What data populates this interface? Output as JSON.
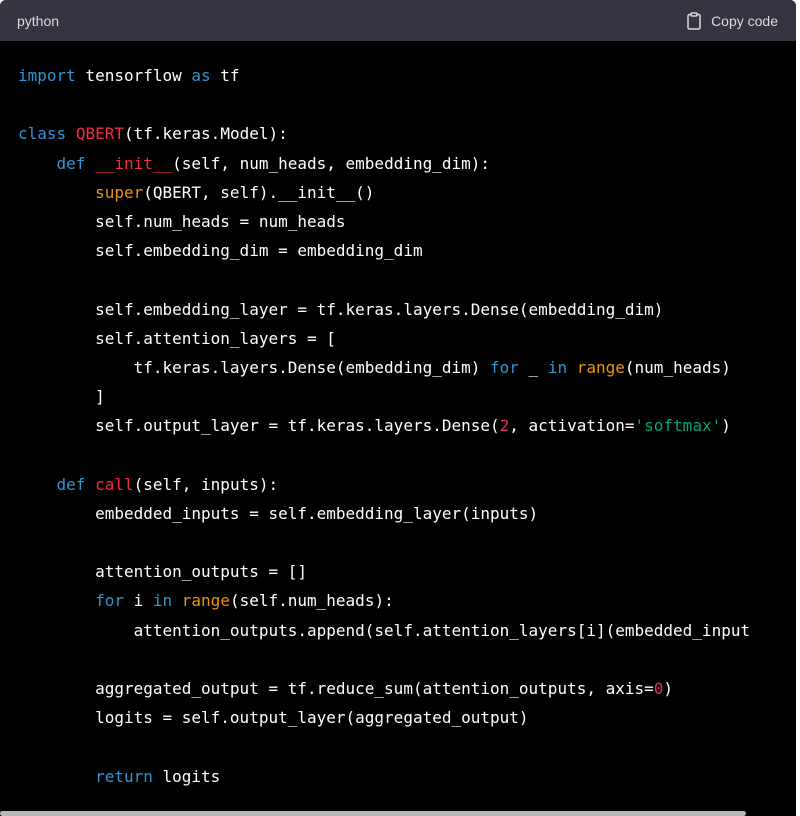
{
  "header": {
    "language": "python",
    "copy_label": "Copy code"
  },
  "colors": {
    "keyword": "#2e95d3",
    "class_name": "#f22c3d",
    "builtin": "#e9950c",
    "string": "#00a67d",
    "number": "#df3079",
    "header_bg": "#343541",
    "code_bg": "#000000"
  },
  "icons": {
    "copy": "clipboard-icon"
  },
  "code_lines": [
    [
      {
        "t": "kw",
        "v": "import"
      },
      {
        "t": "p",
        "v": " tensorflow "
      },
      {
        "t": "kw",
        "v": "as"
      },
      {
        "t": "p",
        "v": " tf"
      }
    ],
    [],
    [
      {
        "t": "kw",
        "v": "class"
      },
      {
        "t": "p",
        "v": " "
      },
      {
        "t": "cls",
        "v": "QBERT"
      },
      {
        "t": "p",
        "v": "(tf.keras.Model):"
      }
    ],
    [
      {
        "t": "p",
        "v": "    "
      },
      {
        "t": "kw",
        "v": "def"
      },
      {
        "t": "p",
        "v": " "
      },
      {
        "t": "cls",
        "v": "__init__"
      },
      {
        "t": "p",
        "v": "(self, num_heads, embedding_dim):"
      }
    ],
    [
      {
        "t": "p",
        "v": "        "
      },
      {
        "t": "bi",
        "v": "super"
      },
      {
        "t": "p",
        "v": "(QBERT, self).__init__()"
      }
    ],
    [
      {
        "t": "p",
        "v": "        self.num_heads = num_heads"
      }
    ],
    [
      {
        "t": "p",
        "v": "        self.embedding_dim = embedding_dim"
      }
    ],
    [],
    [
      {
        "t": "p",
        "v": "        self.embedding_layer = tf.keras.layers.Dense(embedding_dim)"
      }
    ],
    [
      {
        "t": "p",
        "v": "        self.attention_layers = ["
      }
    ],
    [
      {
        "t": "p",
        "v": "            tf.keras.layers.Dense(embedding_dim) "
      },
      {
        "t": "kw",
        "v": "for"
      },
      {
        "t": "p",
        "v": " _ "
      },
      {
        "t": "kw",
        "v": "in"
      },
      {
        "t": "p",
        "v": " "
      },
      {
        "t": "bi",
        "v": "range"
      },
      {
        "t": "p",
        "v": "(num_heads)"
      }
    ],
    [
      {
        "t": "p",
        "v": "        ]"
      }
    ],
    [
      {
        "t": "p",
        "v": "        self.output_layer = tf.keras.layers.Dense("
      },
      {
        "t": "num",
        "v": "2"
      },
      {
        "t": "p",
        "v": ", activation="
      },
      {
        "t": "str",
        "v": "'softmax'"
      },
      {
        "t": "p",
        "v": ")"
      }
    ],
    [],
    [
      {
        "t": "p",
        "v": "    "
      },
      {
        "t": "kw",
        "v": "def"
      },
      {
        "t": "p",
        "v": " "
      },
      {
        "t": "cls",
        "v": "call"
      },
      {
        "t": "p",
        "v": "(self, inputs):"
      }
    ],
    [
      {
        "t": "p",
        "v": "        embedded_inputs = self.embedding_layer(inputs)"
      }
    ],
    [],
    [
      {
        "t": "p",
        "v": "        attention_outputs = []"
      }
    ],
    [
      {
        "t": "p",
        "v": "        "
      },
      {
        "t": "kw",
        "v": "for"
      },
      {
        "t": "p",
        "v": " i "
      },
      {
        "t": "kw",
        "v": "in"
      },
      {
        "t": "p",
        "v": " "
      },
      {
        "t": "bi",
        "v": "range"
      },
      {
        "t": "p",
        "v": "(self.num_heads):"
      }
    ],
    [
      {
        "t": "p",
        "v": "            attention_outputs.append(self.attention_layers[i](embedded_input"
      }
    ],
    [],
    [
      {
        "t": "p",
        "v": "        aggregated_output = tf.reduce_sum(attention_outputs, axis="
      },
      {
        "t": "num",
        "v": "0"
      },
      {
        "t": "p",
        "v": ")"
      }
    ],
    [
      {
        "t": "p",
        "v": "        logits = self.output_layer(aggregated_output)"
      }
    ],
    [],
    [
      {
        "t": "p",
        "v": "        "
      },
      {
        "t": "kw",
        "v": "return"
      },
      {
        "t": "p",
        "v": " logits"
      }
    ]
  ]
}
